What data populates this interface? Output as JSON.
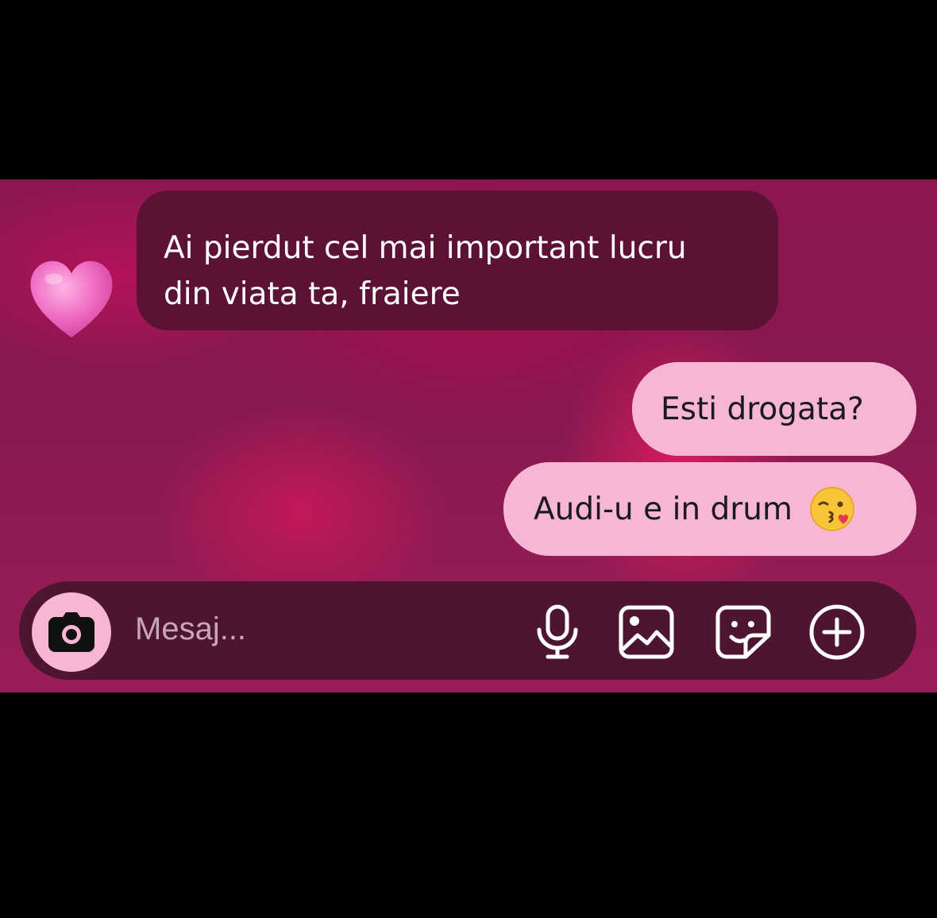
{
  "chat": {
    "incoming": {
      "reaction_icon": "pink-heart-icon",
      "lines": [
        "Ai pierdut cel mai important lucru",
        "din viata ta, fraiere"
      ]
    },
    "outgoing": [
      {
        "text": "Esti drogata?"
      },
      {
        "text": "Audi-u e in drum",
        "emoji": "kissing-face-emoji"
      }
    ]
  },
  "composer": {
    "placeholder": "Mesaj...",
    "icons": [
      "camera-icon",
      "microphone-icon",
      "gallery-icon",
      "sticker-icon",
      "add-icon"
    ]
  },
  "colors": {
    "background": "#8e1650",
    "incoming_bubble": "#5c1234",
    "outgoing_bubble": "#f7b6d4",
    "composer": "#4e1530",
    "letterbox": "#000000"
  }
}
